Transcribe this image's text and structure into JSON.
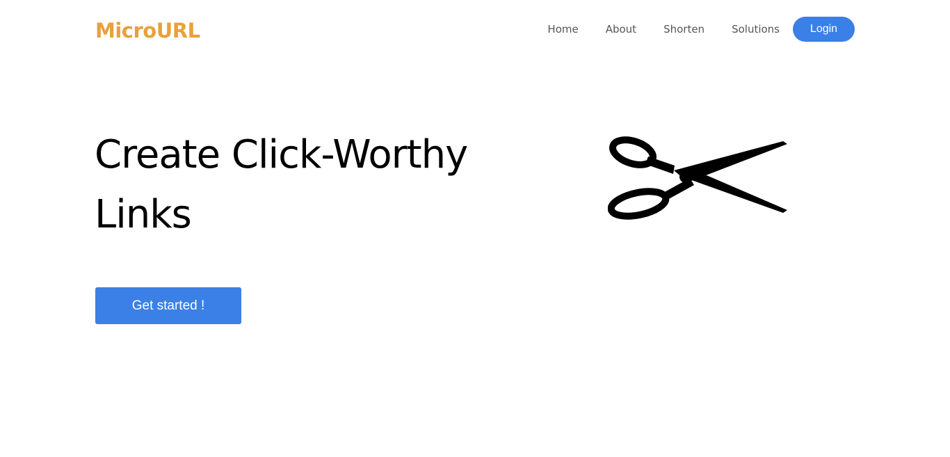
{
  "brand": {
    "name": "MicroURL",
    "color": "#e8a13c"
  },
  "nav": {
    "items": [
      {
        "label": "Home"
      },
      {
        "label": "About"
      },
      {
        "label": "Shorten"
      },
      {
        "label": "Solutions"
      }
    ],
    "login_label": "Login"
  },
  "hero": {
    "title": "Create Click-Worthy Links",
    "cta_label": "Get started !",
    "illustration": "scissors-icon"
  },
  "colors": {
    "accent": "#3b80e6",
    "text": "#000000",
    "nav_text": "#555555"
  }
}
